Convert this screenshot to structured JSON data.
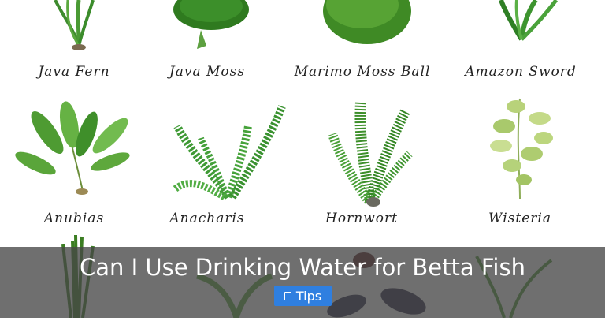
{
  "plants": [
    {
      "name": "Java Fern"
    },
    {
      "name": "Java Moss"
    },
    {
      "name": "Marimo Moss Ball"
    },
    {
      "name": "Amazon Sword"
    },
    {
      "name": "Anubias"
    },
    {
      "name": "Anacharis"
    },
    {
      "name": "Hornwort"
    },
    {
      "name": "Wisteria"
    }
  ],
  "overlay": {
    "title": "Can I Use Drinking Water for Betta Fish",
    "tag_label": "Tips",
    "tag_icon": "folder-icon",
    "tag_color": "#2f7fe0"
  }
}
